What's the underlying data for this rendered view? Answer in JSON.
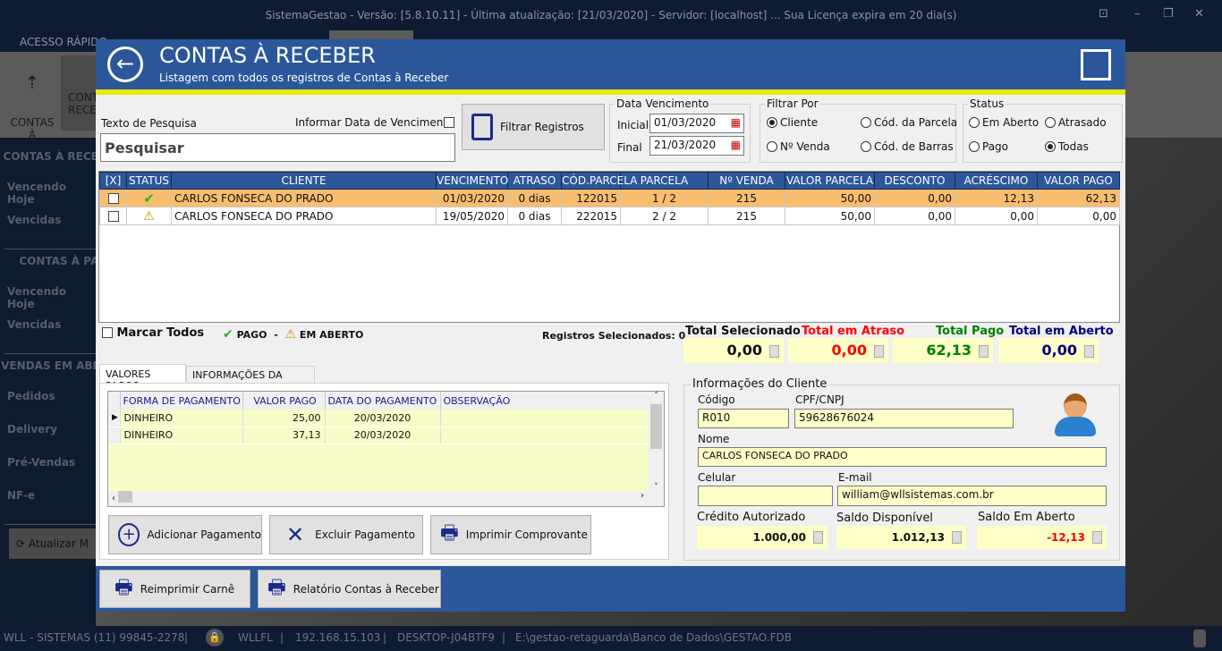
{
  "app": {
    "title": "SistemaGestao - Versão: [5.8.10.11] - Última atualização: [21/03/2020] - Servidor: [localhost] ... Sua Licença expira em 20 dia(s)",
    "menu_first": "ACESSO RÁPIDO"
  },
  "ribbon": {
    "contas_pagar": "CONTAS\nÀ PAGAR",
    "contas_receber": "CONT\nRECE"
  },
  "sidebar": {
    "h1": "CONTAS À RECEBER",
    "h2": "CONTAS À PAGAR",
    "h3": "VENDAS EM ABERTO",
    "items": [
      "Vencendo Hoje",
      "Vencidas",
      "Vencendo Hoje",
      "Vencidas",
      "Pedidos",
      "Delivery",
      "Pré-Vendas",
      "NF-e"
    ],
    "refresh": "Atualizar M"
  },
  "statusbar": {
    "company": "WLL - SISTEMAS (11) 99845-2278",
    "user": "WLLFL",
    "ip": "192.168.15.103",
    "host": "DESKTOP-J04BTF9",
    "db": "E:\\gestao-retaguarda\\Banco de Dados\\GESTAO.FDB"
  },
  "modal": {
    "title": "CONTAS À RECEBER",
    "subtitle": "Listagem com todos os registros de Contas à Receber",
    "search": {
      "label": "Texto de Pesquisa",
      "placeholder": "Pesquisar",
      "date_check": "Informar Data de Vencimento",
      "filter_btn": "Filtrar Registros"
    },
    "date": {
      "legend": "Data Vencimento",
      "start_label": "Inicial",
      "start": "01/03/2020",
      "end_label": "Final",
      "end": "21/03/2020"
    },
    "filter": {
      "legend": "Filtrar Por",
      "options": [
        "Cliente",
        "Cód. da Parcela",
        "Nº Venda",
        "Cód. de Barras"
      ],
      "selected": "Cliente"
    },
    "status": {
      "legend": "Status",
      "options": [
        "Em Aberto",
        "Atrasado",
        "Pago",
        "Todas"
      ],
      "selected": "Todas"
    },
    "table": {
      "headers": [
        "[X]",
        "STATUS",
        "CLIENTE",
        "VENCIMENTO",
        "ATRASO",
        "CÓD.PARCELA",
        "PARCELA",
        "Nº VENDA",
        "VALOR  PARCELA",
        "DESCONTO",
        "ACRÉSCIMO",
        "VALOR PAGO"
      ],
      "rows": [
        {
          "status": "pago",
          "cliente": "CARLOS FONSECA DO PRADO",
          "vencimento": "01/03/2020",
          "atraso": "0 dias",
          "cod": "122015",
          "parcela": "1 / 2",
          "venda": "215",
          "valor": "50,00",
          "desconto": "0,00",
          "acrescimo": "12,13",
          "pago": "62,13"
        },
        {
          "status": "aberto",
          "cliente": "CARLOS FONSECA DO PRADO",
          "vencimento": "19/05/2020",
          "atraso": "0 dias",
          "cod": "222015",
          "parcela": "2 / 2",
          "venda": "215",
          "valor": "50,00",
          "desconto": "0,00",
          "acrescimo": "0,00",
          "pago": "0,00"
        }
      ]
    },
    "legend": {
      "mark_all": "Marcar Todos",
      "pago": "PAGO",
      "sep": "-",
      "aberto": "EM ABERTO",
      "selected": "Registros Selecionados: 0"
    },
    "totals": {
      "sel_label": "Total Selecionado",
      "sel": "0,00",
      "atraso_label": "Total em Atraso",
      "atraso": "0,00",
      "pago_label": "Total Pago",
      "pago": "62,13",
      "aberto_label": "Total em Aberto",
      "aberto": "0,00"
    },
    "tabs": [
      "VALORES PAGOS",
      "INFORMAÇÕES DA VENDA"
    ],
    "payments": {
      "headers": [
        "FORMA DE PAGAMENTO",
        "VALOR PAGO",
        "DATA DO PAGAMENTO",
        "OBSERVAÇÃO"
      ],
      "rows": [
        {
          "forma": "DINHEIRO",
          "valor": "25,00",
          "data": "20/03/2020",
          "obs": ""
        },
        {
          "forma": "DINHEIRO",
          "valor": "37,13",
          "data": "20/03/2020",
          "obs": ""
        }
      ]
    },
    "pay_buttons": {
      "add": "Adicionar Pagamento",
      "delete": "Excluir Pagamento",
      "print": "Imprimir Comprovante"
    },
    "client": {
      "legend": "Informações do Cliente",
      "codigo_label": "Código",
      "codigo": "R010",
      "cpf_label": "CPF/CNPJ",
      "cpf": "59628676024",
      "nome_label": "Nome",
      "nome": "CARLOS FONSECA DO PRADO",
      "celular_label": "Celular",
      "celular": "",
      "email_label": "E-mail",
      "email": "william@wllsistemas.com.br",
      "credito_label": "Crédito Autorizado",
      "credito": "1.000,00",
      "disp_label": "Saldo Disponível",
      "disp": "1.012,13",
      "aberto_label": "Saldo Em Aberto",
      "aberto": "-12,13"
    },
    "footer": {
      "carne": "Reimprimir Carnê",
      "relatorio": "Relatório Contas à Receber"
    }
  },
  "colors": {
    "header": "#2b579a",
    "stripe": "#e8e800",
    "selected_row": "#f8bd6e",
    "field": "#ffffc8",
    "red": "#ff0000",
    "green": "#008000",
    "navy": "#000080"
  }
}
